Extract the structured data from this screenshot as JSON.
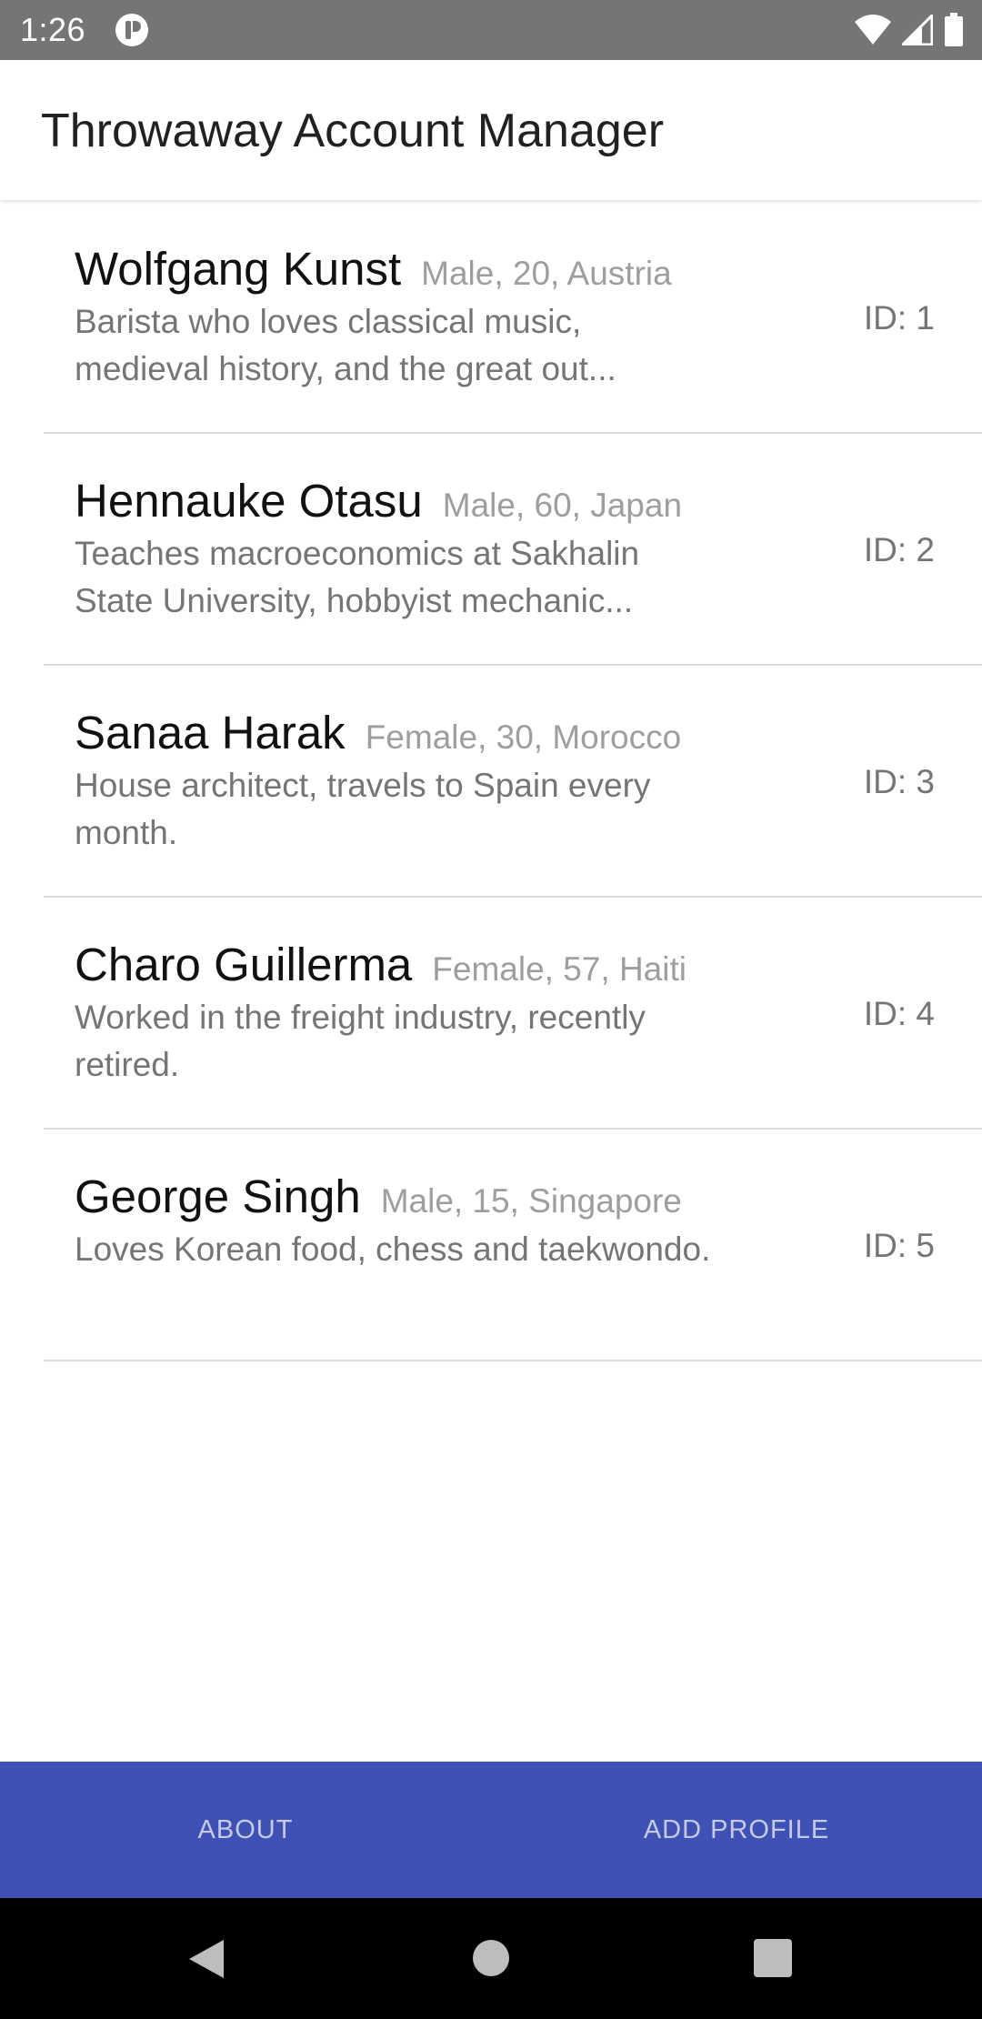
{
  "status_bar": {
    "time": "1:26",
    "icons": [
      "notification-app-icon",
      "wifi-icon",
      "cell-signal-icon",
      "battery-icon"
    ]
  },
  "app_bar": {
    "title": "Throwaway Account Manager"
  },
  "profiles": [
    {
      "name": "Wolfgang Kunst",
      "meta": "Male, 20, Austria",
      "description": "Barista who loves classical music, medieval history, and the great out...",
      "id": "ID: 1"
    },
    {
      "name": "Hennauke Otasu",
      "meta": "Male, 60, Japan",
      "description": "Teaches macroeconomics at Sakhalin State University, hobbyist mechanic...",
      "id": "ID: 2"
    },
    {
      "name": "Sanaa Harak",
      "meta": "Female, 30, Morocco",
      "description": "House architect, travels to Spain every month.",
      "id": "ID: 3"
    },
    {
      "name": "Charo Guillerma",
      "meta": "Female, 57, Haiti",
      "description": "Worked in the freight industry, recently retired.",
      "id": "ID: 4"
    },
    {
      "name": "George Singh",
      "meta": "Male, 15, Singapore",
      "description": "Loves Korean food, chess and taekwondo.",
      "id": "ID: 5"
    }
  ],
  "bottom_bar": {
    "about_label": "ABOUT",
    "add_profile_label": "ADD PROFILE"
  },
  "nav_bar": {
    "icons": [
      "back-icon",
      "home-icon",
      "recents-icon"
    ]
  },
  "colors": {
    "status_bar": "#757575",
    "accent_bar": "#3f51b5",
    "accent_text": "#c5cae9",
    "nav_bar": "#000000"
  }
}
